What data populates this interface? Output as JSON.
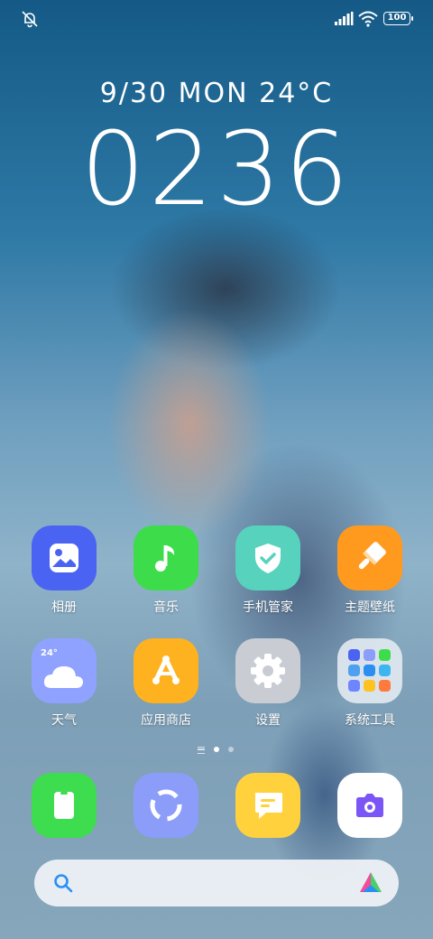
{
  "status_bar": {
    "battery": "100"
  },
  "lockscreen": {
    "date": "9/30 MON 24°C",
    "time": "0236"
  },
  "apps": [
    {
      "label": "相册"
    },
    {
      "label": "音乐"
    },
    {
      "label": "手机管家"
    },
    {
      "label": "主题壁纸"
    },
    {
      "label": "天气",
      "temp": "24°"
    },
    {
      "label": "应用商店"
    },
    {
      "label": "设置"
    },
    {
      "label": "系统工具"
    }
  ],
  "dock": [
    "phone-app",
    "browser-app",
    "messages-app",
    "camera-app"
  ],
  "colors": {
    "gallery": "#4b63f2",
    "music": "#3ddc4b",
    "security": "#57d3bd",
    "themes": "#ff9a1f",
    "weather": "#8fa2ff",
    "appstore": "#ffb21f",
    "settings": "#c9cdd3",
    "phone": "#3edc4f",
    "browser": "#8b9df9",
    "messages": "#ffd23d",
    "camera": "#ffffff"
  },
  "page_indicator": {
    "pages": 2,
    "current": 1
  }
}
